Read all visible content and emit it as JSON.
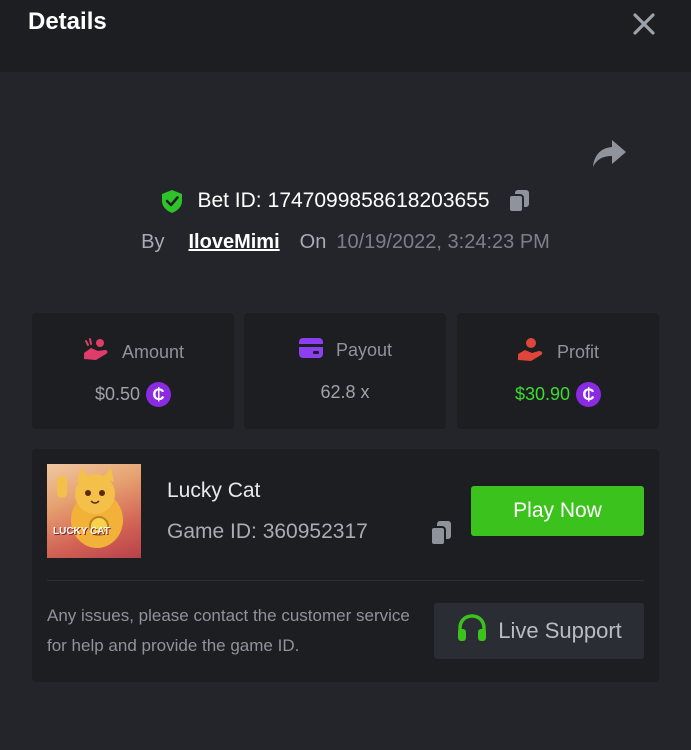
{
  "header": {
    "title": "Details"
  },
  "bet": {
    "label": "Bet ID:",
    "id": "1747099858618203655",
    "by_label": "By",
    "user": "IloveMimi",
    "on_label": "On",
    "date": "10/19/2022, 3:24:23 PM"
  },
  "stats": {
    "amount": {
      "label": "Amount",
      "value": "$0.50",
      "coin": "₵"
    },
    "payout": {
      "label": "Payout",
      "value": "62.8 x"
    },
    "profit": {
      "label": "Profit",
      "value": "$30.90",
      "coin": "₵"
    }
  },
  "game": {
    "name": "Lucky Cat",
    "id_text": "Game ID: 360952317",
    "thumb_text": "LUCKY CAT",
    "play_label": "Play Now",
    "issue_text": "Any issues, please contact the customer service for help and provide the game ID.",
    "support_label": "Live Support"
  },
  "colors": {
    "background": "#23252a",
    "header": "#1c1e22",
    "green": "#3cc21c",
    "profit": "#3ddc2e",
    "coin": "#8a2be2",
    "amount_icon": "#e03c6a",
    "payout_icon": "#8b3ff0",
    "profit_icon": "#e0453c"
  },
  "icons": {
    "close": "close-icon",
    "share": "share-icon",
    "verified": "shield-check-icon",
    "copy": "copy-icon",
    "amount": "hand-coin-icon",
    "payout": "wallet-card-icon",
    "profit": "profit-hand-icon",
    "support": "headset-icon"
  }
}
